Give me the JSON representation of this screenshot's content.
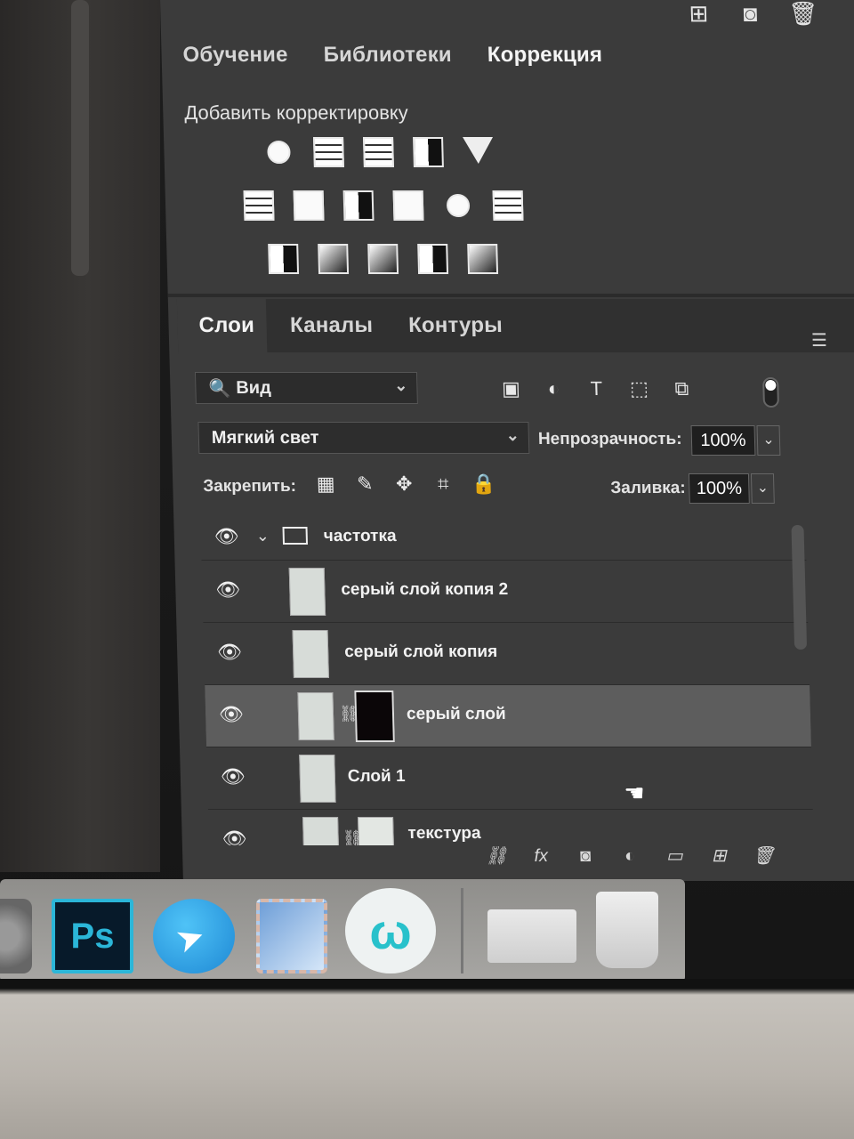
{
  "top_tabs": [
    "Обучение",
    "Библиотеки",
    "Коррекция"
  ],
  "top_icons": [
    "new-layer-icon",
    "camera-icon",
    "trash-icon"
  ],
  "adjustments": {
    "title": "Добавить корректировку"
  },
  "layers_panel": {
    "tabs": [
      "Слои",
      "Каналы",
      "Контуры"
    ],
    "filter_label": "Вид",
    "blend_mode": "Мягкий свет",
    "opacity_label": "Непрозрачность:",
    "opacity_value": "100%",
    "lock_label": "Закрепить:",
    "fill_label": "Заливка:",
    "fill_value": "100%",
    "layers": [
      {
        "name": "частотка",
        "type": "group"
      },
      {
        "name": "серый слой копия 2",
        "type": "layer"
      },
      {
        "name": "серый слой копия",
        "type": "layer"
      },
      {
        "name": "серый слой",
        "type": "layer-with-mask",
        "selected": true
      },
      {
        "name": "Слой 1",
        "type": "layer"
      },
      {
        "name": "текстура",
        "type": "layer-with-mask"
      }
    ]
  },
  "dock": {
    "ps_label": "Ps",
    "w_label": "ω"
  },
  "colors": {
    "panel_bg": "#3b3b3b",
    "selected_row": "#5d5d5d",
    "ps_accent": "#2bb6d8",
    "telegram": "#1e88d4"
  }
}
